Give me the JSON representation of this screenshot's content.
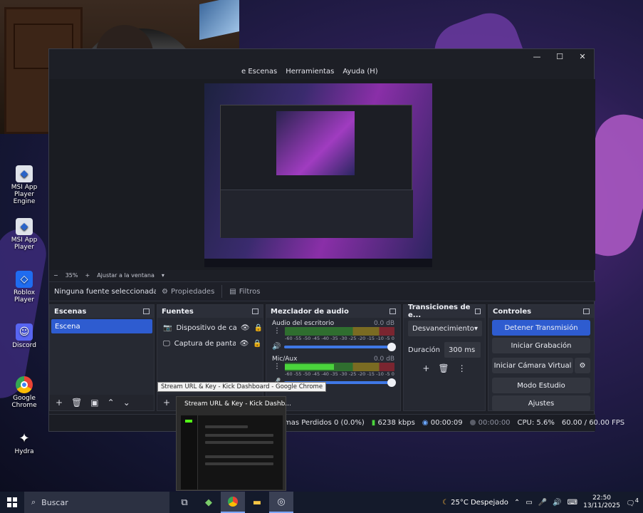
{
  "desktop": {
    "icons": [
      {
        "label_line1": "MSI App Player",
        "label_line2": "Engine",
        "icon": "msi-app-player-icon"
      },
      {
        "label_line1": "MSI App Player",
        "label_line2": "",
        "icon": "msi-app-player-icon"
      },
      {
        "label_line1": "Roblox Player",
        "label_line2": "",
        "icon": "roblox-icon"
      },
      {
        "label_line1": "Discord",
        "label_line2": "",
        "icon": "discord-icon"
      },
      {
        "label_line1": "Google Chrome",
        "label_line2": "",
        "icon": "chrome-icon"
      },
      {
        "label_line1": "Hydra",
        "label_line2": "",
        "icon": "hydra-icon"
      }
    ]
  },
  "obs": {
    "window_controls": {
      "minimize": "—",
      "maximize": "☐",
      "close": "✕"
    },
    "menu": {
      "escenas": "e Escenas",
      "herramientas": "Herramientas",
      "ayuda": "Ayuda (H)"
    },
    "zoom": {
      "minus": "−",
      "level": "35%",
      "plus": "+",
      "fit": "Ajustar a la ventana",
      "dropdown": "▾"
    },
    "sourcebar": {
      "no_source": "Ninguna fuente seleccionada",
      "properties": "Propiedades",
      "filters": "Filtros"
    },
    "scenes": {
      "title": "Escenas",
      "items": [
        "Escena"
      ]
    },
    "sources": {
      "title": "Fuentes",
      "items": [
        "Dispositivo de captura",
        "Captura de pantalla"
      ]
    },
    "mixer": {
      "title": "Mezclador de audio",
      "scale": [
        "-60",
        "-55",
        "-50",
        "-45",
        "-40",
        "-35",
        "-30",
        "-25",
        "-20",
        "-15",
        "-10",
        "-5",
        "0"
      ],
      "channels": [
        {
          "name": "Audio del escritorio",
          "db": "0.0 dB",
          "level": 0.0
        },
        {
          "name": "Mic/Aux",
          "db": "0.0 dB",
          "level": 0.45
        }
      ]
    },
    "transitions": {
      "title": "Transiciones de e...",
      "selected": "Desvanecimiento",
      "duration_label": "Duración",
      "duration_value": "300 ms"
    },
    "controls": {
      "title": "Controles",
      "buttons": [
        "Detener Transmisión",
        "Iniciar Grabación",
        "Iniciar Cámara Virtual",
        "Modo Estudio",
        "Ajustes"
      ]
    },
    "status": {
      "dropped": "mas Perdidos 0 (0.0%)",
      "bitrate": "6238 kbps",
      "live_time": "00:00:09",
      "rec_time": "00:00:00",
      "cpu": "CPU: 5.6%",
      "fps": "60.00 / 60.00 FPS"
    }
  },
  "tooltip": "Stream URL & Key - Kick Dashboard - Google Chrome",
  "chrome_thumb": {
    "title": "Stream URL & Key - Kick Dashb..."
  },
  "taskbar": {
    "search_placeholder": "Buscar",
    "weather": "25°C  Despejado",
    "time": "22:50",
    "date": "13/11/2025",
    "notifications": "4"
  },
  "colors": {
    "accent": "#2e5cd0",
    "kick_green": "#53fc18",
    "obs_bg": "#1d1f26"
  }
}
